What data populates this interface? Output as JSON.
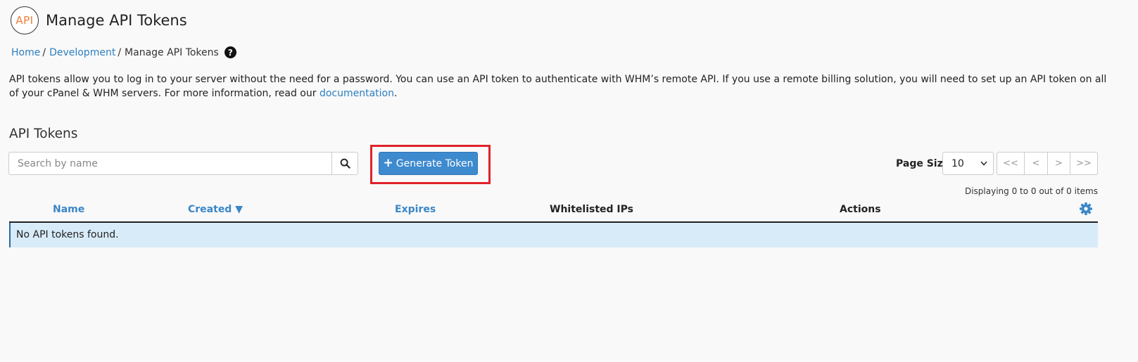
{
  "header": {
    "logo_text": "API",
    "title": "Manage API Tokens"
  },
  "breadcrumb": {
    "home": "Home",
    "development": "Development",
    "current": "Manage API Tokens",
    "separator": "/"
  },
  "description": {
    "text": "API tokens allow you to log in to your server without the need for a password. You can use an API token to authenticate with WHM’s remote API. If you use a remote billing solution, you will need to set up an API token on all of your cPanel & WHM servers. For more information, read our ",
    "link": "documentation",
    "end": "."
  },
  "section_title": "API Tokens",
  "search": {
    "placeholder": "Search by name",
    "value": ""
  },
  "generate_button": {
    "label": "Generate Token"
  },
  "page_size": {
    "label": "Page Size",
    "value": "10"
  },
  "pager": {
    "first": "<<",
    "prev": "<",
    "next": ">",
    "last": ">>"
  },
  "displaying": "Displaying 0 to 0 out of 0 items",
  "table": {
    "columns": [
      {
        "label": "Name"
      },
      {
        "label": "Created ▼"
      },
      {
        "label": "Expires"
      },
      {
        "label": "Whitelisted IPs"
      },
      {
        "label": "Actions"
      }
    ],
    "empty_message": "No API tokens found."
  },
  "icons": {
    "help": "help-icon",
    "search": "search-icon",
    "plus": "plus-icon",
    "gear": "gear-icon",
    "chevron": "chevron-down-icon"
  },
  "colors": {
    "accent": "#3e8acf",
    "highlight": "#e0222a",
    "row_bg": "#d8ebf8",
    "link": "#2d7fc1"
  }
}
